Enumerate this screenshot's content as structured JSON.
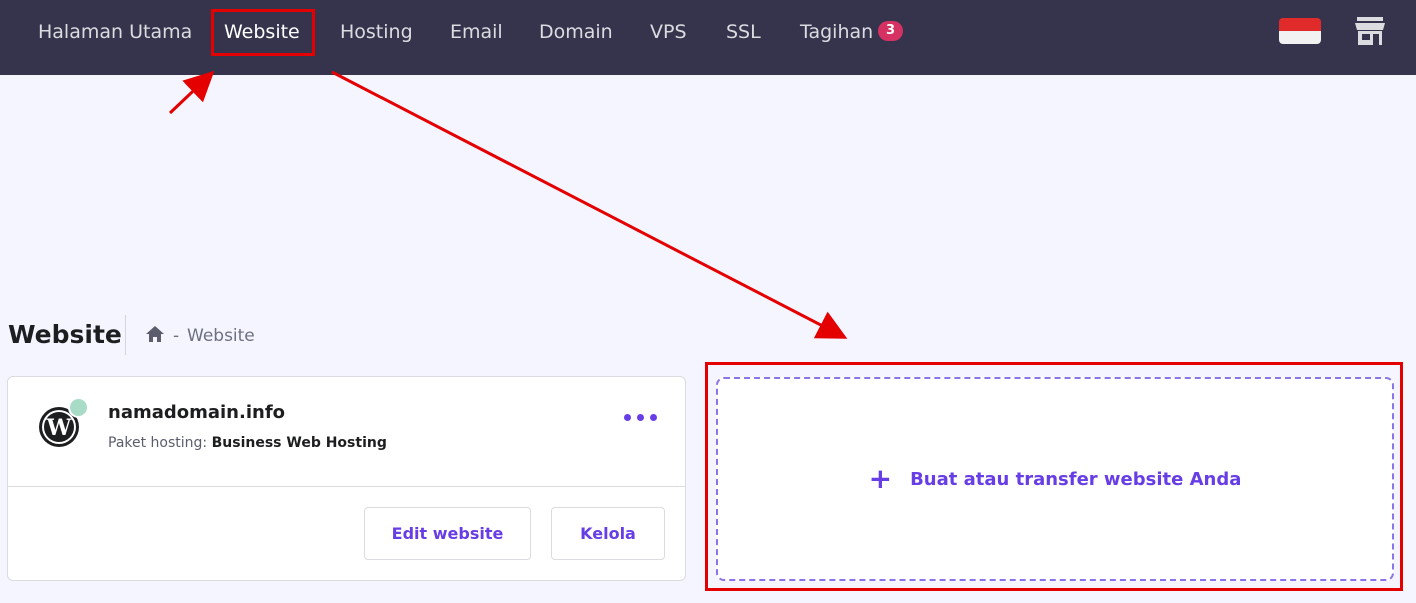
{
  "nav": {
    "items": [
      {
        "label": "Halaman Utama",
        "active": false
      },
      {
        "label": "Website",
        "active": true
      },
      {
        "label": "Hosting",
        "active": false
      },
      {
        "label": "Email",
        "active": false
      },
      {
        "label": "Domain",
        "active": false
      },
      {
        "label": "VPS",
        "active": false
      },
      {
        "label": "SSL",
        "active": false
      },
      {
        "label": "Tagihan",
        "active": false
      }
    ],
    "billing_badge": "3",
    "icons": [
      "indonesia-flag-icon",
      "store-icon"
    ]
  },
  "page": {
    "title": "Website",
    "breadcrumb": {
      "home_icon": "home-icon",
      "separator": "-",
      "current": "Website"
    }
  },
  "site_card": {
    "domain": "namadomain.info",
    "plan_label": "Paket hosting:",
    "plan_value": "Business Web Hosting",
    "status_color": "#a9dcc6",
    "edit_label": "Edit website",
    "manage_label": "Kelola"
  },
  "add_card": {
    "plus": "+",
    "label": "Buat atau transfer website Anda"
  },
  "colors": {
    "nav_background": "#36344d",
    "page_background": "#f4f5ff",
    "accent": "#673de6",
    "badge": "#d63163",
    "annotation": "#e50000"
  }
}
